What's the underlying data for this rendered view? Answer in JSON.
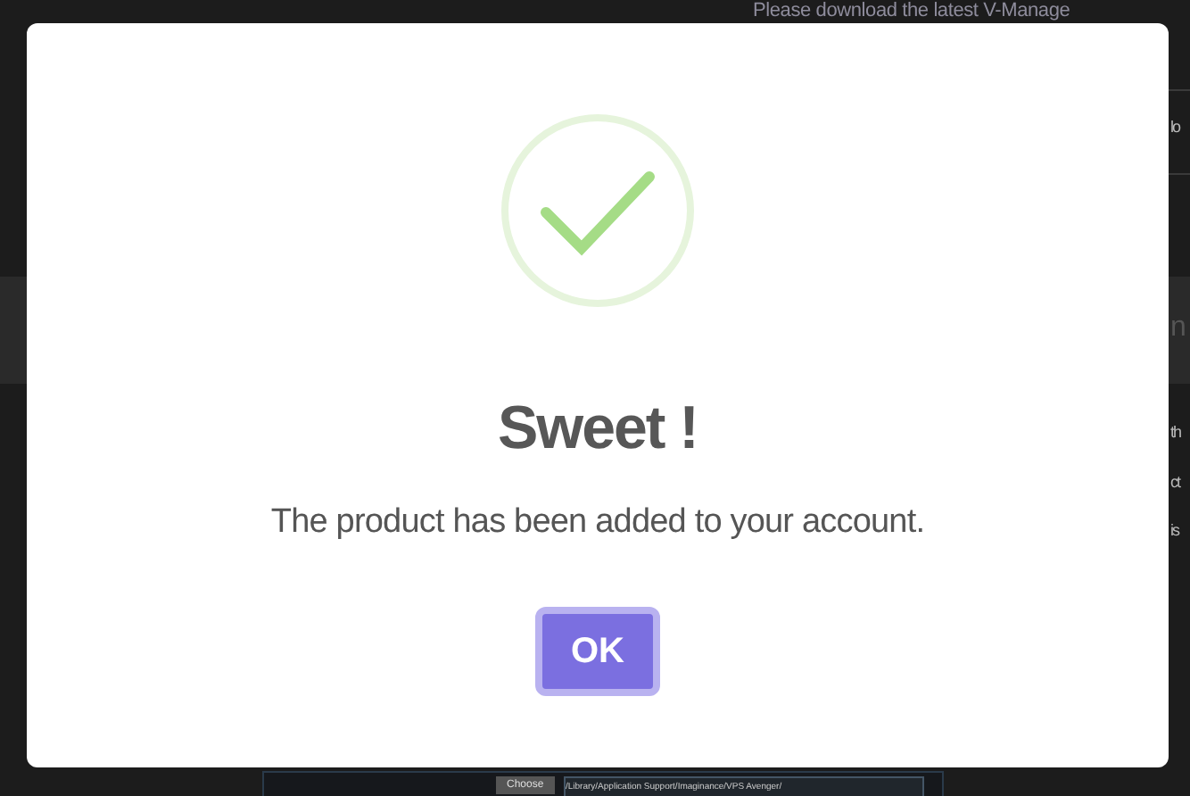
{
  "background": {
    "notice": "Please download the latest V-Manage",
    "side_texts": [
      "lo",
      "n",
      "th",
      "ct",
      "is"
    ],
    "embedded_screenshot": {
      "button": "Choose",
      "path": "/Library/Application Support/Imaginance/VPS Avenger/"
    }
  },
  "dialog": {
    "title": "Sweet !",
    "message": "The product has been added to your account.",
    "button": "OK"
  }
}
